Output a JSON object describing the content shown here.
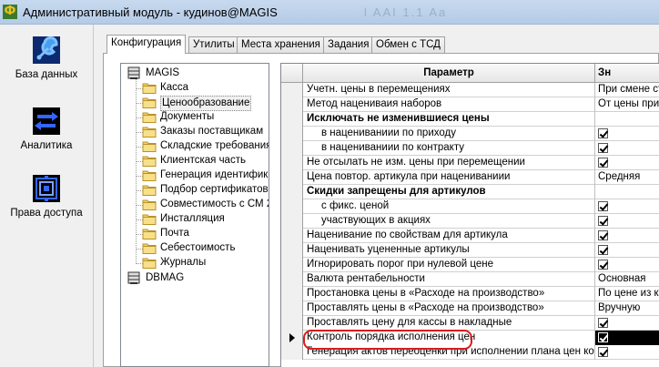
{
  "window": {
    "title": "Административный модуль - кудинов@MAGIS",
    "ghost_text": "l AAI 1.1 Aa"
  },
  "nav": {
    "items": [
      {
        "label": "База данных",
        "icon": "database-wrench-icon"
      },
      {
        "label": "Аналитика",
        "icon": "analytics-arrows-icon"
      },
      {
        "label": "Права доступа",
        "icon": "access-rights-icon"
      }
    ]
  },
  "tabs": [
    {
      "label": "Конфигурация"
    },
    {
      "label": "Утилиты"
    },
    {
      "label": "Места хранения"
    },
    {
      "label": "Задания"
    },
    {
      "label": "Обмен с ТСД"
    }
  ],
  "tree": {
    "root": "MAGIS",
    "children": [
      "Касса",
      "Ценообразование",
      "Документы",
      "Заказы поставщикам",
      "Складские требования",
      "Клиентская часть",
      "Генерация идентифика",
      "Подбор сертификатов с",
      "Совместимость с СМ 2",
      "Инсталляция",
      "Почта",
      "Себестоимость",
      "Журналы"
    ],
    "selected": "Ценообразование",
    "root2": "DBMAG"
  },
  "grid": {
    "header_param": "Параметр",
    "header_value": "Зн",
    "rows": [
      {
        "param": "Учетн. цены в перемещениях",
        "value": "При смене ст",
        "kind": "text"
      },
      {
        "param": "Метод нацениваия наборов",
        "value": "От цены приход",
        "kind": "text"
      },
      {
        "param": "Исключать не изменившиеся цены",
        "kind": "group"
      },
      {
        "param": "в нацениваниии по приходу",
        "kind": "check",
        "indent": true
      },
      {
        "param": "в нацениваниии по контракту",
        "kind": "check",
        "indent": true
      },
      {
        "param": "Не отсылать не изм. цены при перемещении",
        "kind": "check"
      },
      {
        "param": "Цена повтор. артикула при нацениваниии",
        "value": "Средняя",
        "kind": "text"
      },
      {
        "param": "Скидки запрещены для артикулов",
        "kind": "group"
      },
      {
        "param": "с фикс. ценой",
        "kind": "check",
        "indent": true
      },
      {
        "param": "участвующих в акциях",
        "kind": "check",
        "indent": true
      },
      {
        "param": "Наценивание по свойствам для артикула",
        "kind": "check"
      },
      {
        "param": "Наценивать уцененные артикулы",
        "kind": "check"
      },
      {
        "param": "Игнорировать порог при нулевой цене",
        "kind": "check"
      },
      {
        "param": "Валюта рентабельности",
        "value": "Основная",
        "kind": "text"
      },
      {
        "param": "Простановка цены в «Расходе на производство»",
        "value": "По цене из ка",
        "kind": "text"
      },
      {
        "param": "Проставлять цены в «Расходе на производство»",
        "value": "Вручную",
        "kind": "text"
      },
      {
        "param": "Проставлять цену для кассы в накладные",
        "kind": "check"
      },
      {
        "param": "Контроль порядка исполнения цен",
        "kind": "check",
        "current": true
      },
      {
        "param": "Генерация актов переоценки при исполнении плана цен конт",
        "kind": "check"
      }
    ]
  },
  "colors": {
    "highlight": "#d81c1c",
    "titlebar": "#b4cbe6"
  }
}
